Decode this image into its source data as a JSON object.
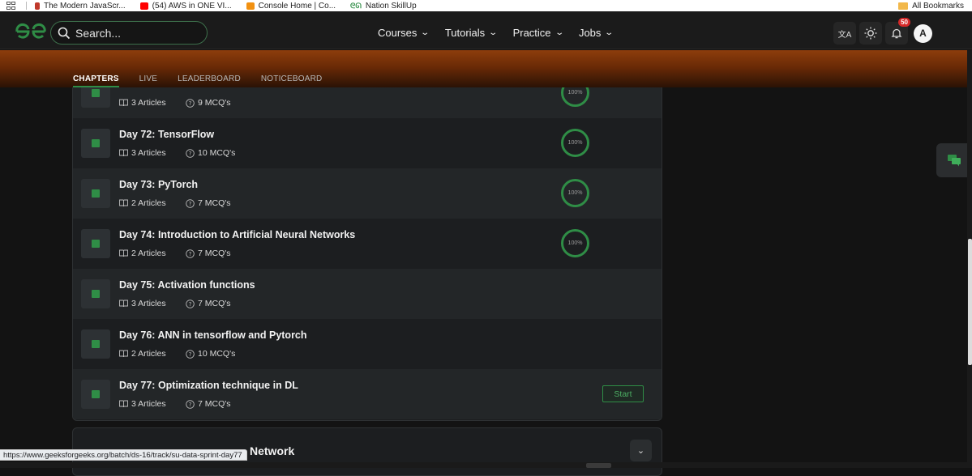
{
  "bookmarks": {
    "items": [
      {
        "label": "The Modern JavaScr...",
        "icon": "js-favicon",
        "color": "#c0392b"
      },
      {
        "label": "(54) AWS in ONE VI...",
        "icon": "youtube-favicon",
        "color": "#ff0000"
      },
      {
        "label": "Console Home | Co...",
        "icon": "aws-favicon",
        "color": "#f90"
      },
      {
        "label": "Nation SkillUp",
        "icon": "gfg-favicon",
        "color": "#2f8d46"
      }
    ],
    "all_label": "All Bookmarks"
  },
  "nav": {
    "search_placeholder": "Search...",
    "menu": [
      "Courses",
      "Tutorials",
      "Practice",
      "Jobs"
    ],
    "notification_count": "50",
    "avatar_letter": "A"
  },
  "tabs": [
    "CHAPTERS",
    "LIVE",
    "LEADERBOARD",
    "NOTICEBOARD"
  ],
  "rows": [
    {
      "title": "",
      "articles": "3 Articles",
      "mcqs": "9 MCQ's",
      "progress": "100%",
      "action": ""
    },
    {
      "title": "Day 72: TensorFlow",
      "articles": "3 Articles",
      "mcqs": "10 MCQ's",
      "progress": "100%",
      "action": ""
    },
    {
      "title": "Day 73: PyTorch",
      "articles": "2 Articles",
      "mcqs": "7 MCQ's",
      "progress": "100%",
      "action": ""
    },
    {
      "title": "Day 74: Introduction to Artificial Neural Networks",
      "articles": "2 Articles",
      "mcqs": "7 MCQ's",
      "progress": "100%",
      "action": ""
    },
    {
      "title": "Day 75: Activation functions",
      "articles": "3 Articles",
      "mcqs": "7 MCQ's",
      "progress": "",
      "action": ""
    },
    {
      "title": "Day 76: ANN in tensorflow and Pytorch",
      "articles": "2 Articles",
      "mcqs": "10 MCQ's",
      "progress": "",
      "action": ""
    },
    {
      "title": "Day 77: Optimization technique in DL",
      "articles": "3 Articles",
      "mcqs": "7 MCQ's",
      "progress": "",
      "action": "Start"
    }
  ],
  "next_section": {
    "title": "Network"
  },
  "status_url": "https://www.geeksforgeeks.org/batch/ds-16/track/su-data-sprint-day77",
  "colors": {
    "accent": "#2f8d46",
    "hero": "#8d3d0c",
    "background": "#131313"
  }
}
